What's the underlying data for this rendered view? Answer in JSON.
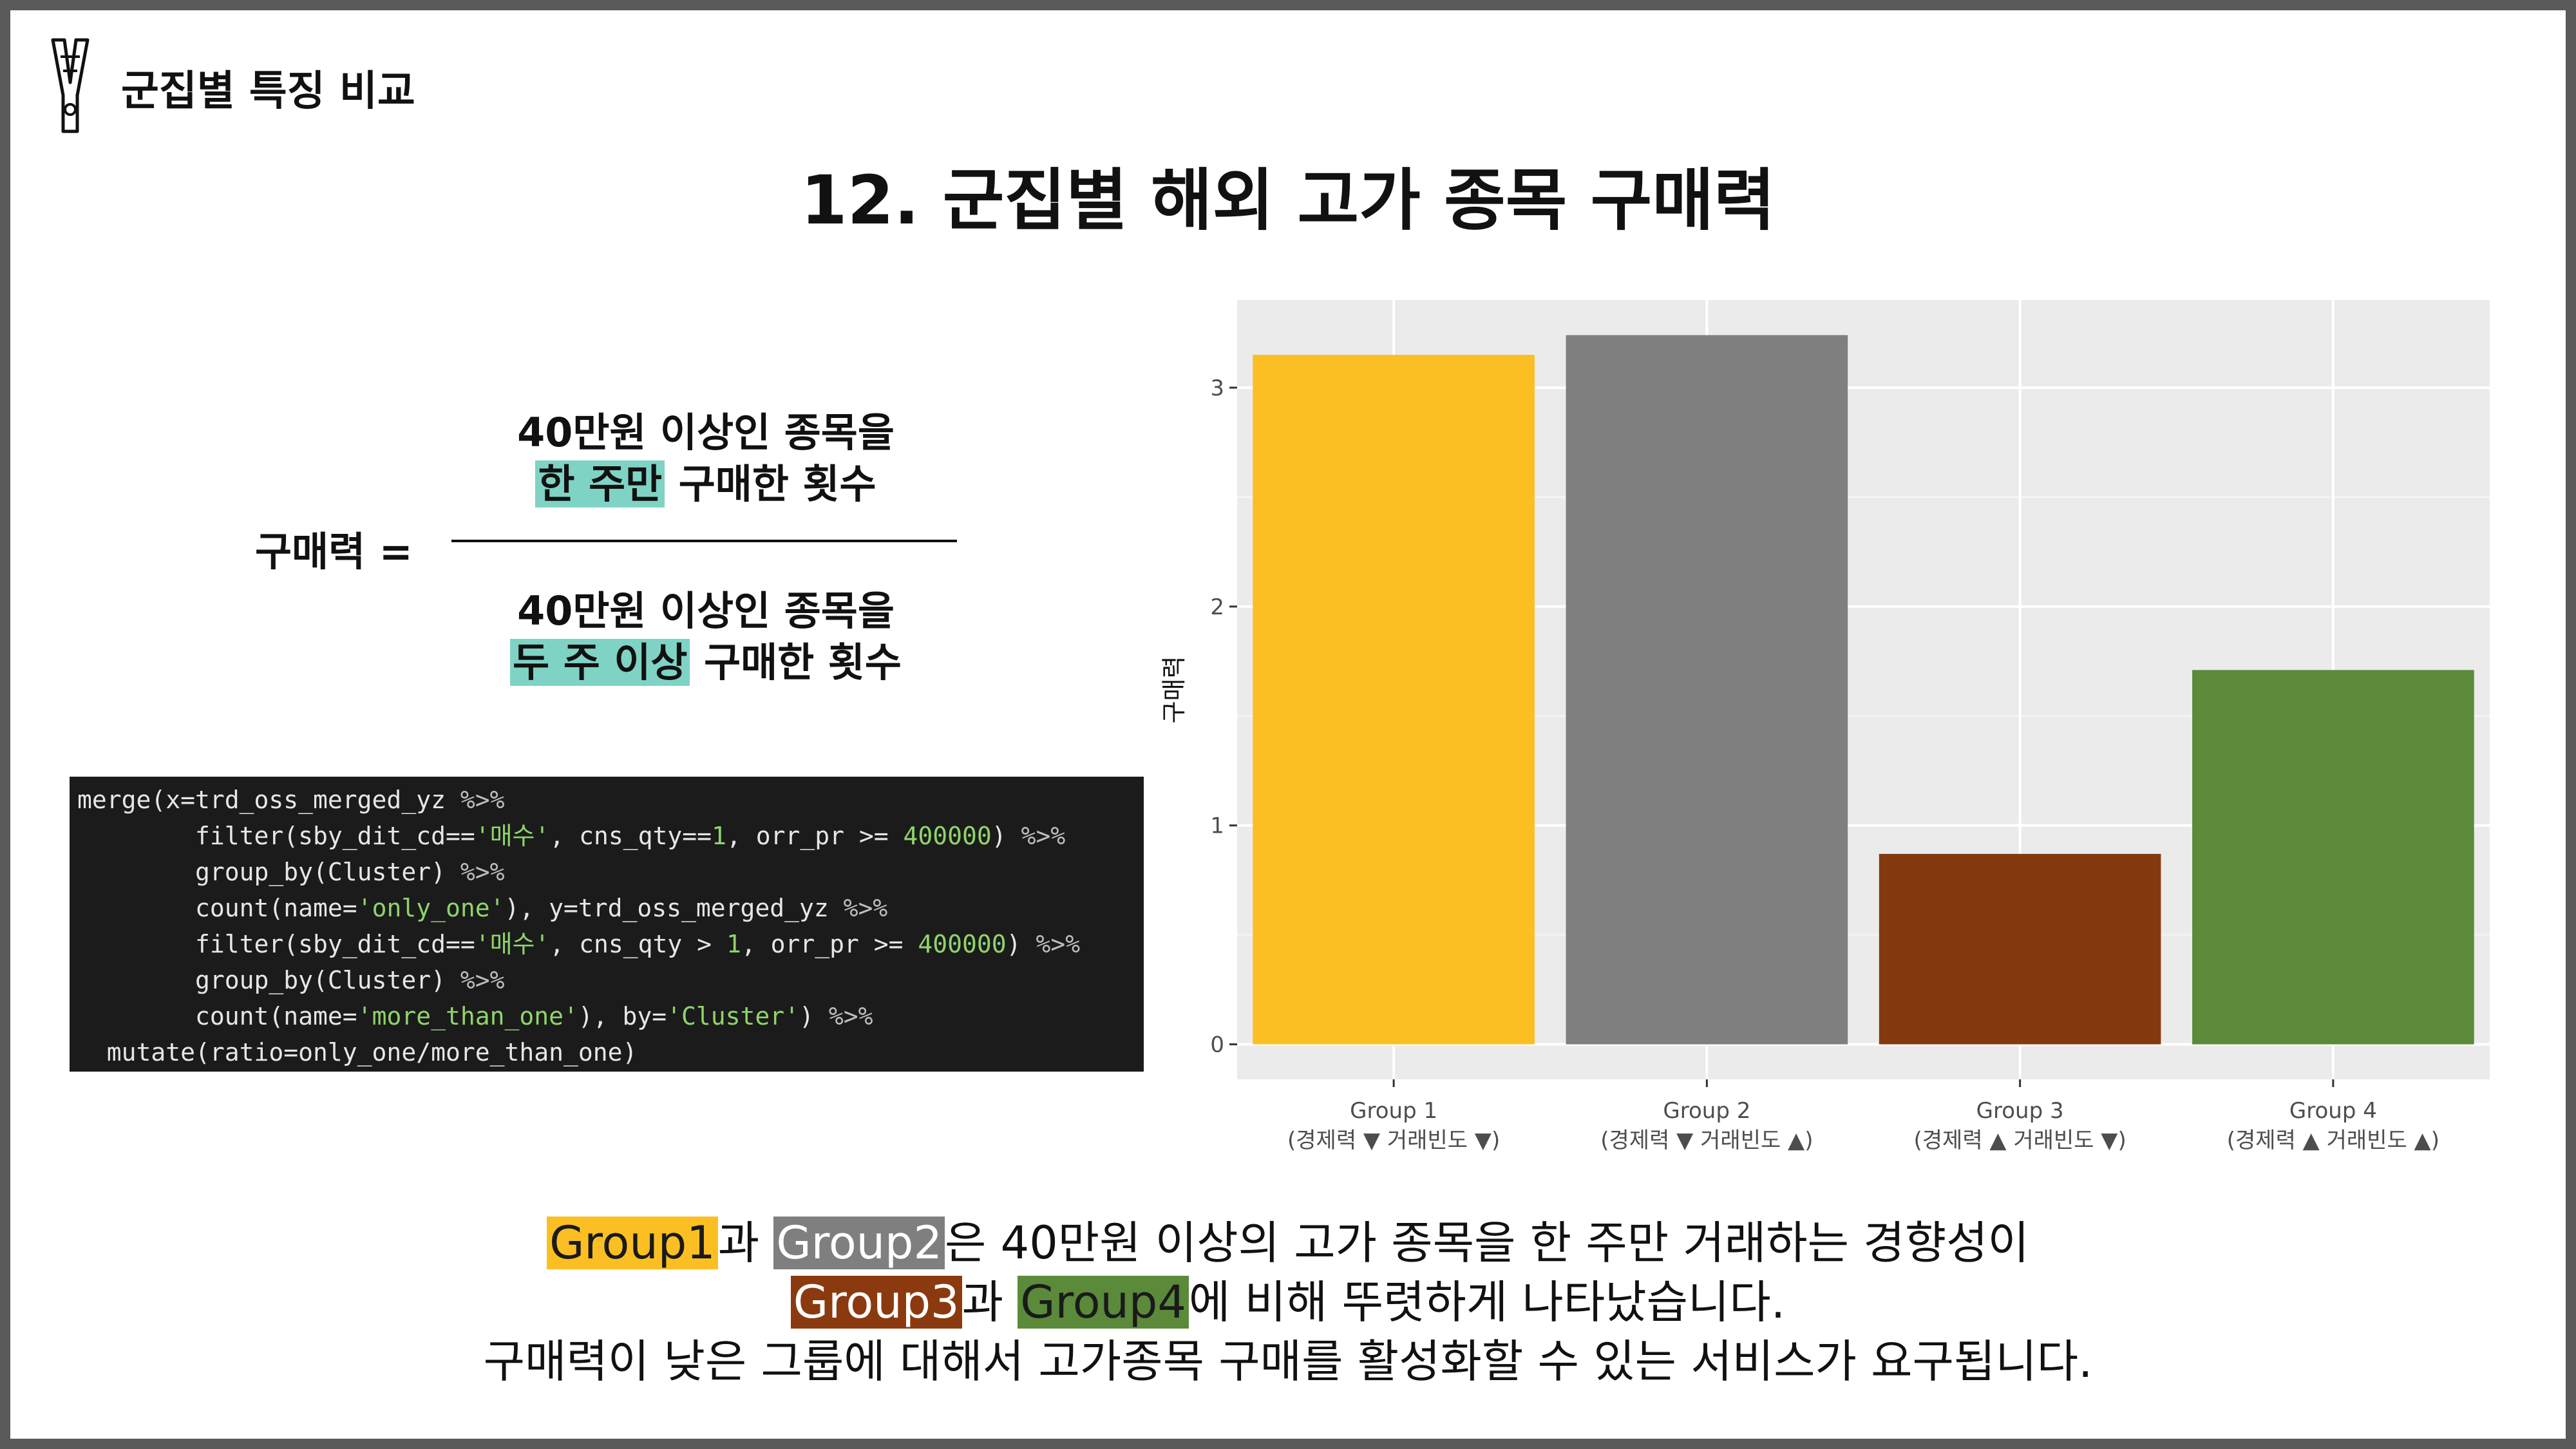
{
  "header": {
    "section_label": "군집별 특징 비교",
    "title": "12. 군집별 해외 고가 종목 구매력"
  },
  "formula": {
    "label": "구매력 =",
    "numerator": {
      "line1": "40만원 이상인 종목을",
      "highlight": "한 주만",
      "rest": " 구매한 횟수"
    },
    "denominator": {
      "line1": "40만원 이상인 종목을",
      "highlight": "두 주 이상",
      "rest": " 구매한 횟수"
    },
    "highlight_color": "#7ed3c4"
  },
  "code": {
    "lines": [
      [
        {
          "t": "merge(x=trd_oss_merged_yz ",
          "k": "fn"
        },
        {
          "t": "%>%",
          "k": "op"
        }
      ],
      [
        {
          "t": "        filter(sby_dit_cd==",
          "k": "fn"
        },
        {
          "t": "'매수'",
          "k": "str"
        },
        {
          "t": ", cns_qty==",
          "k": "fn"
        },
        {
          "t": "1",
          "k": "num"
        },
        {
          "t": ", orr_pr >= ",
          "k": "fn"
        },
        {
          "t": "400000",
          "k": "num"
        },
        {
          "t": ") ",
          "k": "fn"
        },
        {
          "t": "%>%",
          "k": "op"
        }
      ],
      [
        {
          "t": "        group_by(Cluster) ",
          "k": "fn"
        },
        {
          "t": "%>%",
          "k": "op"
        }
      ],
      [
        {
          "t": "        count(name=",
          "k": "fn"
        },
        {
          "t": "'only_one'",
          "k": "str"
        },
        {
          "t": "), y=trd_oss_merged_yz ",
          "k": "fn"
        },
        {
          "t": "%>%",
          "k": "op"
        }
      ],
      [
        {
          "t": "        filter(sby_dit_cd==",
          "k": "fn"
        },
        {
          "t": "'매수'",
          "k": "str"
        },
        {
          "t": ", cns_qty > ",
          "k": "fn"
        },
        {
          "t": "1",
          "k": "num"
        },
        {
          "t": ", orr_pr >= ",
          "k": "fn"
        },
        {
          "t": "400000",
          "k": "num"
        },
        {
          "t": ") ",
          "k": "fn"
        },
        {
          "t": "%>%",
          "k": "op"
        }
      ],
      [
        {
          "t": "        group_by(Cluster) ",
          "k": "fn"
        },
        {
          "t": "%>%",
          "k": "op"
        }
      ],
      [
        {
          "t": "        count(name=",
          "k": "fn"
        },
        {
          "t": "'more_than_one'",
          "k": "str"
        },
        {
          "t": "), by=",
          "k": "fn"
        },
        {
          "t": "'Cluster'",
          "k": "str"
        },
        {
          "t": ") ",
          "k": "fn"
        },
        {
          "t": "%>%",
          "k": "op"
        }
      ],
      [
        {
          "t": "  mutate(ratio=only_one/more_than_one)",
          "k": "fn"
        }
      ]
    ]
  },
  "chart_data": {
    "type": "bar",
    "categories": [
      [
        "Group 1",
        "(경제력 ▼ 거래빈도 ▼)"
      ],
      [
        "Group 2",
        "(경제력 ▼ 거래빈도 ▲)"
      ],
      [
        "Group 3",
        "(경제력 ▲ 거래빈도 ▼)"
      ],
      [
        "Group 4",
        "(경제력 ▲ 거래빈도 ▲)"
      ]
    ],
    "values": [
      3.15,
      3.24,
      0.87,
      1.71
    ],
    "colors": [
      "#fbbf24",
      "#7f7f7f",
      "#843a0e",
      "#5a8a3a"
    ],
    "ylabel": "구매력",
    "xlabel": "",
    "ylim": [
      -0.16,
      3.4
    ],
    "yticks": [
      0,
      1,
      2,
      3
    ],
    "grid": true,
    "panel_background": "#ebebeb"
  },
  "conclusion": {
    "line1": {
      "g1": "Group1",
      "t1": "과 ",
      "g2": "Group2",
      "t2": "은 40만원 이상의 고가 종목을 한 주만 거래하는 경향성이"
    },
    "line2": {
      "g3": "Group3",
      "t1": "과 ",
      "g4": "Group4",
      "t2": "에 비해 뚜렷하게 나타났습니다."
    },
    "line3": "구매력이 낮은 그룹에 대해서 고가종목 구매를 활성화할 수 있는 서비스가 요구됩니다."
  }
}
